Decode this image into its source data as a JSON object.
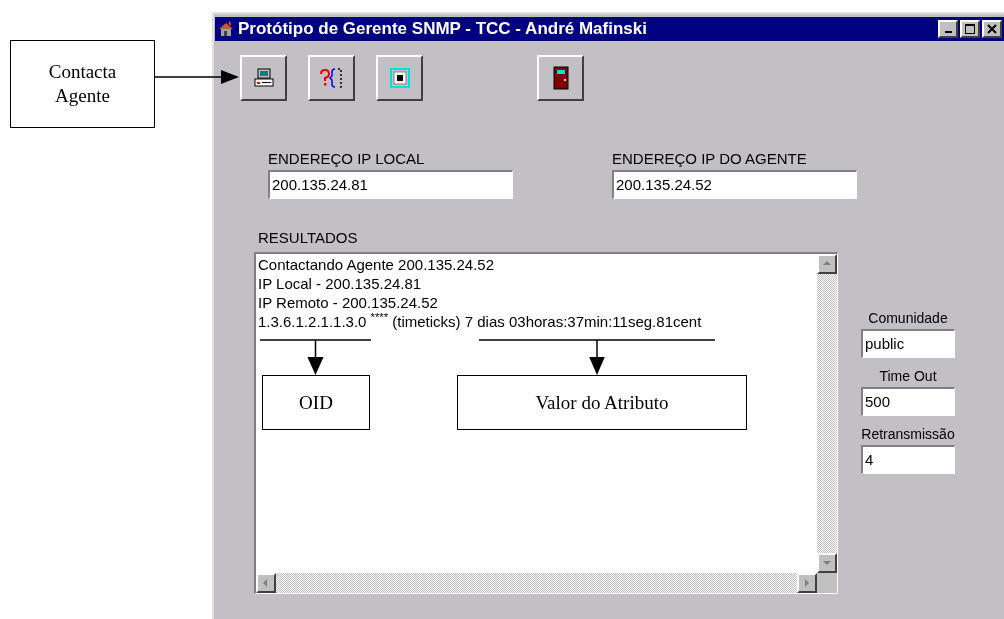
{
  "window": {
    "title": "Protótipo de Gerente SNMP - TCC - André Mafinski"
  },
  "toolbar": [
    {
      "kind": "computer"
    },
    {
      "kind": "query"
    },
    {
      "kind": "stop"
    },
    {
      "kind": "exit"
    }
  ],
  "address_fields": [
    {
      "label": "ENDEREÇO IP LOCAL",
      "value": "200.135.24.81"
    },
    {
      "label": "ENDEREÇO IP DO AGENTE",
      "value": "200.135.24.52"
    }
  ],
  "results": {
    "label": "RESULTADOS",
    "lines": [
      "Contactando Agente  200.135.24.52",
      "IP Local - 200.135.24.81",
      "IP Remoto - 200.135.24.52",
      "1.3.6.1.2.1.1.3.0 $^{****}$ (timeticks) 7 dias 03horas:37min:11seg.81cent"
    ]
  },
  "settings": [
    {
      "label": "Comunidade",
      "value": "public"
    },
    {
      "label": "Time Out",
      "value": "500"
    },
    {
      "label": "Retransmissão",
      "value": "4"
    }
  ],
  "annotations": [
    {
      "kind": "side",
      "text": "Contacta Agente"
    },
    {
      "kind": "below",
      "text": "OID"
    },
    {
      "kind": "below",
      "text": "Valor do Atributo"
    }
  ]
}
